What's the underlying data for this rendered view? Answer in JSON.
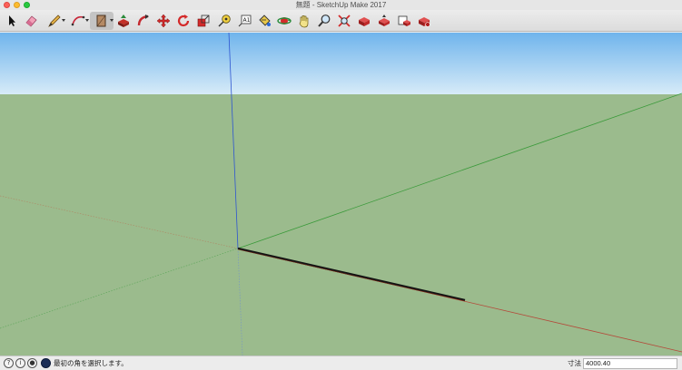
{
  "window": {
    "title": "無題 - SketchUp Make 2017"
  },
  "toolbar": {
    "tools": [
      {
        "name": "select-tool",
        "icon": "arrow-cursor-icon"
      },
      {
        "name": "eraser-tool",
        "icon": "eraser-icon"
      },
      {
        "name": "line-tool",
        "icon": "pencil-icon"
      },
      {
        "name": "arc-tool",
        "icon": "arc-icon"
      },
      {
        "name": "rectangle-tool",
        "icon": "rectangle-icon"
      },
      {
        "name": "push-pull-tool",
        "icon": "push-pull-icon"
      },
      {
        "name": "follow-me-tool",
        "icon": "follow-me-icon"
      },
      {
        "name": "move-tool",
        "icon": "move-arrows-icon"
      },
      {
        "name": "rotate-tool",
        "icon": "rotate-icon"
      },
      {
        "name": "scale-tool",
        "icon": "scale-icon"
      },
      {
        "name": "tape-measure-tool",
        "icon": "tape-measure-icon"
      },
      {
        "name": "text-tool",
        "icon": "text-icon"
      },
      {
        "name": "paint-bucket-tool",
        "icon": "paint-bucket-icon"
      },
      {
        "name": "orbit-tool",
        "icon": "orbit-icon"
      },
      {
        "name": "pan-tool",
        "icon": "pan-hand-icon"
      },
      {
        "name": "zoom-tool",
        "icon": "magnifier-icon"
      },
      {
        "name": "zoom-extents-tool",
        "icon": "zoom-extents-icon"
      },
      {
        "name": "warehouse-tool",
        "icon": "3d-warehouse-icon"
      },
      {
        "name": "share-model-tool",
        "icon": "share-model-icon"
      },
      {
        "name": "extension-warehouse-tool",
        "icon": "extension-warehouse-icon"
      },
      {
        "name": "layout-tool",
        "icon": "layout-icon"
      }
    ]
  },
  "colors": {
    "sky_top": "#6fb4ec",
    "sky_bottom": "#d7ebf8",
    "ground": "#9bbb8d",
    "axis_red": "#b44a3a",
    "axis_green": "#3a9a3a",
    "axis_blue": "#2e55d0",
    "edge": "#141414"
  },
  "statusbar": {
    "message": "最初の角を選択します。",
    "measure_label": "寸法",
    "measure_value": "4000.40",
    "icons": [
      "help-icon",
      "credit-icon",
      "user-icon",
      "geo-location-icon"
    ]
  }
}
